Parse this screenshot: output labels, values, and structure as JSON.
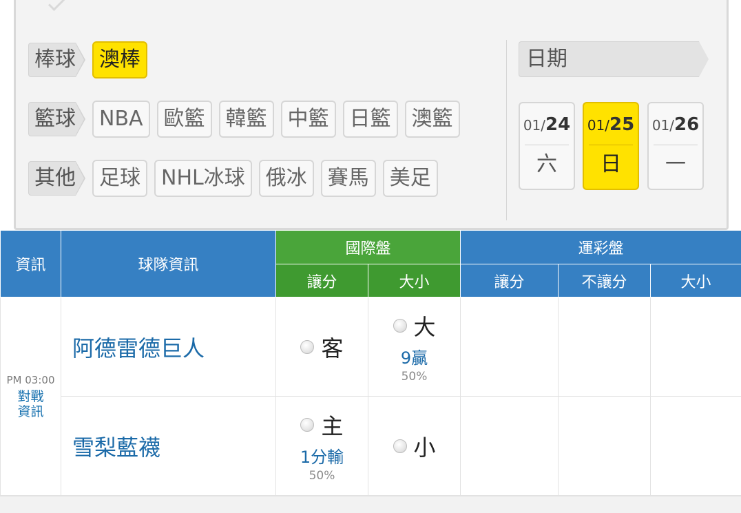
{
  "filters": {
    "rows": [
      {
        "category": "棒球",
        "leagues": [
          "澳棒"
        ],
        "active": 0
      },
      {
        "category": "籃球",
        "leagues": [
          "NBA",
          "歐籃",
          "韓籃",
          "中籃",
          "日籃",
          "澳籃"
        ],
        "active": -1
      },
      {
        "category": "其他",
        "leagues": [
          "足球",
          "NHL冰球",
          "俄冰",
          "賽馬",
          "美足"
        ],
        "active": -1
      }
    ],
    "date_label": "日期",
    "dates": [
      {
        "md_prefix": "01/",
        "day": "24",
        "weekday": "六",
        "active": false
      },
      {
        "md_prefix": "01/",
        "day": "25",
        "weekday": "日",
        "active": true
      },
      {
        "md_prefix": "01/",
        "day": "26",
        "weekday": "一",
        "active": false
      }
    ]
  },
  "table": {
    "headers": {
      "info": "資訊",
      "team_info": "球隊資訊",
      "international": "國際盤",
      "sports_lottery": "運彩盤",
      "handicap": "讓分",
      "over_under": "大小",
      "no_handicap": "不讓分"
    },
    "match": {
      "time": "PM 03:00",
      "info_link_line1": "對戰",
      "info_link_line2": "資訊",
      "away_team": "阿德雷德巨人",
      "home_team": "雪梨藍襪",
      "away_handicap_label": "客",
      "over_label": "大",
      "over_odds": "9贏",
      "over_pct": "50%",
      "home_handicap_label": "主",
      "home_odds": "1分輸",
      "home_pct": "50%",
      "under_label": "小"
    }
  },
  "colors": {
    "highlight": "#ffe200",
    "header_blue": "#3680c3",
    "header_green": "#4aa53a",
    "team_text": "#1b6aa8"
  }
}
